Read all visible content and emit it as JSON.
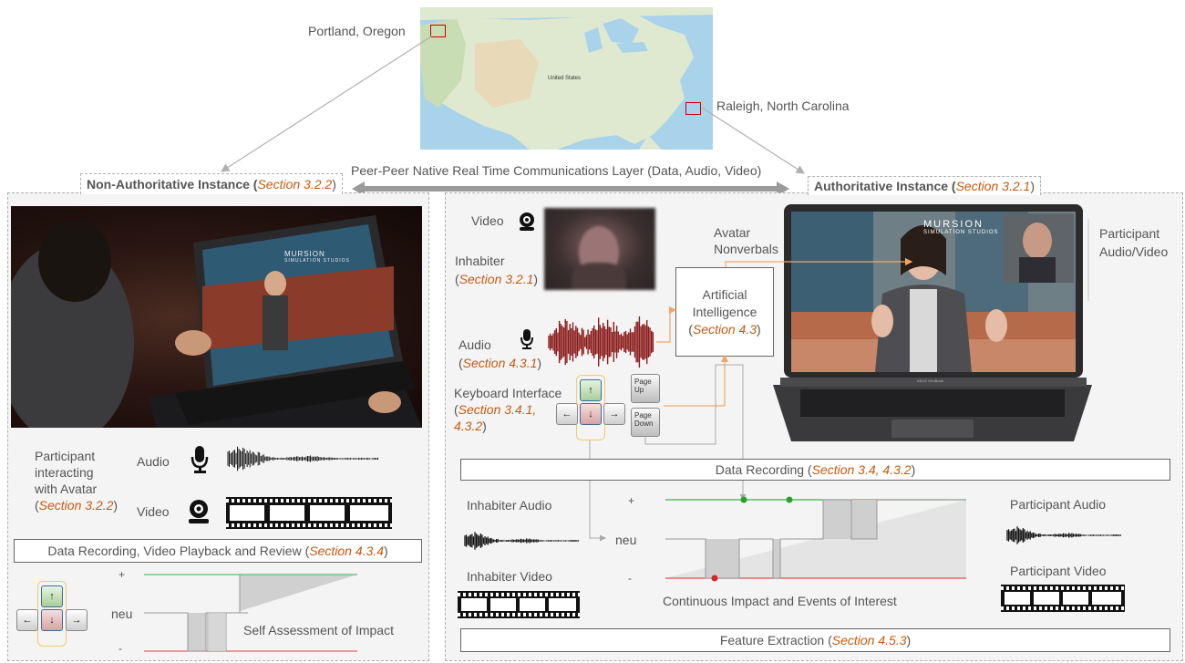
{
  "map": {
    "city_west": "Portland, Oregon",
    "city_east": "Raleigh, North Carolina",
    "country_label": "United States"
  },
  "comm_layer": "Peer-Peer Native Real Time Communications Layer (Data, Audio, Video)",
  "left_panel": {
    "title": "Non-Authoritative Instance (",
    "title_sec": "Section 3.2.2",
    "title_end": ")",
    "participant_line1": "Participant",
    "participant_line2": "interacting",
    "participant_line3": "with Avatar",
    "participant_sec_open": "(",
    "participant_sec": "Section 3.2.2",
    "participant_sec_close": ")",
    "audio_label": "Audio",
    "video_label": "Video",
    "recording_text": "Data Recording, Video Playback and Review (",
    "recording_sec": "Section 4.3.4",
    "recording_end": ")",
    "plus": "+",
    "neu": "neu",
    "minus": "-",
    "self_assessment": "Self Assessment of Impact",
    "key_up": "↑",
    "key_down": "↓",
    "key_left": "←",
    "key_right": "→",
    "laptop_brand_1": "MURSION",
    "laptop_brand_2": "SIMULATION STUDIOS"
  },
  "right_panel": {
    "title": "Authoritative Instance (",
    "title_sec": "Section 3.2.1",
    "title_end": ")",
    "video_label": "Video",
    "inhabiter_label": "Inhabiter",
    "inhabiter_sec_open": "(",
    "inhabiter_sec": "Section 3.2.1",
    "inhabiter_sec_close": ")",
    "audio_label": "Audio",
    "audio_sec_open": "(",
    "audio_sec": "Section 4.3.1",
    "audio_sec_close": ")",
    "keyboard_label": "Keyboard Interface",
    "keyboard_sec_open": "(",
    "keyboard_sec_1": "Section 3.4.1,",
    "keyboard_sec_2": "4.3.2",
    "keyboard_sec_close": ")",
    "avatar_nonverbals_1": "Avatar",
    "avatar_nonverbals_2": "Nonverbals",
    "ai_line1": "Artificial",
    "ai_line2": "Intelligence",
    "ai_sec_open": "(",
    "ai_sec": "Section 4.3",
    "ai_sec_close": ")",
    "participant_av_1": "Participant",
    "participant_av_2": "Audio/Video",
    "recording_text": "Data Recording (",
    "recording_sec": "Section 3.4, 4.3.2",
    "recording_end": ")",
    "inhabiter_audio": "Inhabiter Audio",
    "inhabiter_video": "Inhabiter Video",
    "plus": "+",
    "neu": "neu",
    "minus": "-",
    "continuous_impact": "Continuous Impact and Events of Interest",
    "participant_audio": "Participant Audio",
    "participant_video": "Participant Video",
    "feature_text": "Feature Extraction (",
    "feature_sec": "Section 4.5.3",
    "feature_end": ")",
    "key_up": "↑",
    "key_down": "↓",
    "key_left": "←",
    "key_right": "→",
    "pgup_1": "Page",
    "pgup_2": "Up",
    "pgdn_1": "Page",
    "pgdn_2": "Down",
    "laptop_brand_1": "MURSION",
    "laptop_brand_2": "SIMULATION STUDIOS",
    "laptop_model": "ASUS VivoBook"
  },
  "colors": {
    "accent": "#c55a11",
    "positive": "#2ca02c",
    "negative": "#d62728",
    "panel_bg": "#f4f4f4",
    "dashed": "#b0b0b0"
  }
}
